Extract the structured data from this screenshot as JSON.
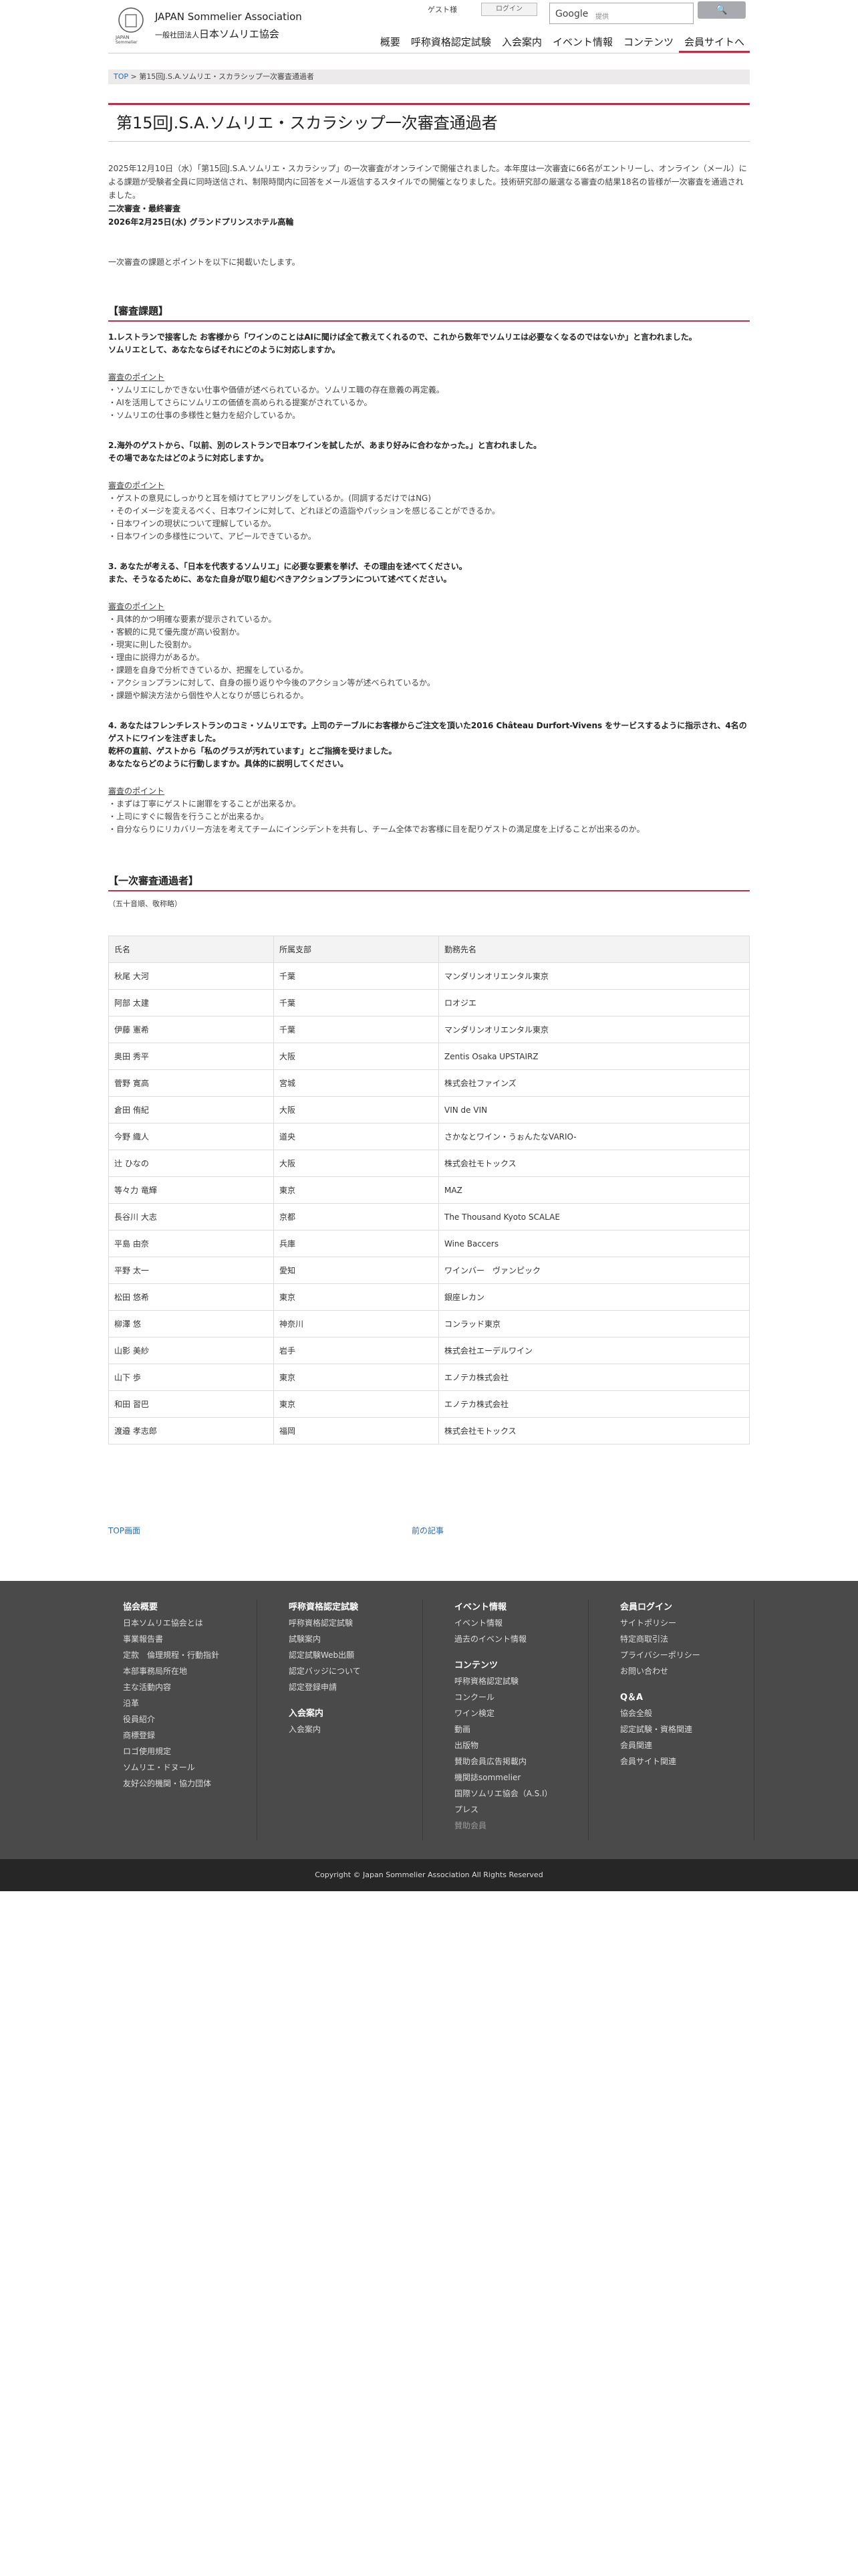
{
  "header": {
    "logo_en": "JAPAN Sommelier Association",
    "logo_jp_small": "一般社団法人",
    "logo_jp": "日本ソムリエ協会",
    "logo_mark_text": "JAPAN Sommelier Association",
    "guest": "ゲスト様",
    "login": "ログイン",
    "search_brand": "Google",
    "search_placeholder": "提供",
    "search_icon": "search-icon",
    "nav": [
      "概要",
      "呼称資格認定試験",
      "入会案内",
      "イベント情報",
      "コンテンツ",
      "会員サイトへ"
    ]
  },
  "breadcrumb": {
    "top": "TOP",
    "sep": " > ",
    "current": "第15回J.S.A.ソムリエ・スカラシップ一次審査通過者"
  },
  "page_title": "第15回J.S.A.ソムリエ・スカラシップ一次審査通過者",
  "intro": {
    "p1": "2025年12月10日（水）「第15回J.S.A.ソムリエ・スカラシップ」の一次審査がオンラインで開催されました。本年度は一次審査に66名がエントリーし、オンライン（メール）による課題が受験者全員に同時送信され、制限時間内に回答をメール返信するスタイルでの開催となりました。技術研究部の厳選なる審査の結果18名の皆様が一次審査を通過されました。",
    "sub_title": "二次審査・最終審査",
    "sub_date": "2026年2月25日(水) グランドプリンスホテル高輪",
    "p2": "一次審査の課題とポイントを以下に掲載いたします。"
  },
  "task_section": {
    "heading": "【審査課題】",
    "questions": [
      {
        "q": [
          "1.レストランで接客した お客様から「ワインのことはAIに聞けば全て教えてくれるので、これから数年でソムリエは必要なくなるのではないか」と言われました。",
          "ソムリエとして、あなたならばそれにどのように対応しますか。"
        ],
        "point_label": "審査のポイント",
        "points": [
          "・ソムリエにしかできない仕事や価値が述べられているか。ソムリエ職の存在意義の再定義。",
          "・AIを活用してさらにソムリエの価値を高められる提案がされているか。",
          "・ソムリエの仕事の多様性と魅力を紹介しているか。"
        ]
      },
      {
        "q": [
          "2.海外のゲストから、「以前、別のレストランで日本ワインを試したが、あまり好みに合わなかった。」と言われました。",
          "その場であなたはどのように対応しますか。"
        ],
        "point_label": "審査のポイント",
        "points": [
          "・ゲストの意見にしっかりと耳を傾けてヒアリングをしているか。(同調するだけではNG)",
          "・そのイメージを変えるべく、日本ワインに対して、どれほどの造詣やパッションを感じることができるか。",
          "・日本ワインの現状について理解しているか。",
          "・日本ワインの多様性について、アピールできているか。"
        ]
      },
      {
        "q": [
          "3. あなたが考える、「日本を代表するソムリエ」に必要な要素を挙げ、その理由を述べてください。",
          "また、そうなるために、あなた自身が取り組むべきアクションプランについて述べてください。"
        ],
        "point_label": "審査のポイント",
        "points": [
          "・具体的かつ明確な要素が提示されているか。",
          "・客観的に見て優先度が高い役割か。",
          "・現実に則した役割か。",
          "・理由に説得力があるか。",
          "・課題を自身で分析できているか、把握をしているか。",
          "・アクションプランに対して、自身の振り返りや今後のアクション等が述べられているか。",
          "・課題や解決方法から個性や人となりが感じられるか。"
        ]
      },
      {
        "q": [
          "4. あなたはフレンチレストランのコミ・ソムリエです。上司のテーブルにお客様からご注文を頂いた2016 Château Durfort-Vivens をサービスするように指示され、4名のゲストにワインを注ぎました。",
          "乾杯の直前、ゲストから「私のグラスが汚れています」とご指摘を受けました。",
          "あなたならどのように行動しますか。具体的に説明してください。"
        ],
        "point_label": "審査のポイント",
        "points": [
          "・まずは丁寧にゲストに謝罪をすることが出来るか。",
          "・上司にすぐに報告を行うことが出来るか。",
          "・自分ならりにリカバリー方法を考えてチームにインシデントを共有し、チーム全体でお客様に目を配りゲストの満足度を上げることが出来るのか。"
        ]
      }
    ]
  },
  "pass_section": {
    "heading": "【一次審査通過者】",
    "note": "（五十音順、敬称略）",
    "columns": [
      "氏名",
      "所属支部",
      "勤務先名"
    ],
    "rows": [
      [
        "秋尾 大河",
        "千葉",
        "マンダリンオリエンタル東京"
      ],
      [
        "阿部 太建",
        "千葉",
        "ロオジエ"
      ],
      [
        "伊藤 憲希",
        "千葉",
        "マンダリンオリエンタル東京"
      ],
      [
        "奥田 秀平",
        "大阪",
        "Zentis Osaka UPSTAIRZ"
      ],
      [
        "菅野 寛高",
        "宮城",
        "株式会社ファインズ"
      ],
      [
        "倉田 侑紀",
        "大阪",
        "VIN de VIN"
      ],
      [
        "今野 織人",
        "道央",
        "さかなとワイン・うぉんたなVARIO-"
      ],
      [
        "辻 ひなの",
        "大阪",
        "株式会社モトックス"
      ],
      [
        "等々力 竜輝",
        "東京",
        "MAZ"
      ],
      [
        "長谷川 大志",
        "京都",
        "The Thousand Kyoto SCALAE"
      ],
      [
        "平島 由奈",
        "兵庫",
        "Wine Baccers"
      ],
      [
        "平野 太一",
        "愛知",
        "ワインバー　ヴァンピック"
      ],
      [
        "松田 悠希",
        "東京",
        "銀座レカン"
      ],
      [
        "柳澤 悠",
        "神奈川",
        "コンラッド東京"
      ],
      [
        "山影 美紗",
        "岩手",
        "株式会社エーデルワイン"
      ],
      [
        "山下 歩",
        "東京",
        "エノテカ株式会社"
      ],
      [
        "和田 習巴",
        "東京",
        "エノテカ株式会社"
      ],
      [
        "渡邉 孝志郎",
        "福岡",
        "株式会社モトックス"
      ]
    ]
  },
  "pager": {
    "top": "TOP画面",
    "prev": "前の記事"
  },
  "footer": {
    "col1": {
      "title": "協会概要",
      "items": [
        "日本ソムリエ協会とは",
        "事業報告書",
        "定款　倫理規程・行動指針",
        "本部事務局所在地",
        "主な活動内容",
        "沿革",
        "役員紹介",
        "商標登録",
        "ロゴ使用規定",
        "ソムリエ・ドヌール",
        "友好公的機関・協力団体"
      ]
    },
    "col2": {
      "title": "呼称資格認定試験",
      "items": [
        "呼称資格認定試験",
        "試験案内",
        "認定試験Web出願",
        "認定バッジについて",
        "認定登録申請"
      ],
      "title2": "入会案内",
      "items2": [
        "入会案内"
      ]
    },
    "col3": {
      "title": "イベント情報",
      "items": [
        "イベント情報",
        "過去のイベント情報"
      ],
      "title2": "コンテンツ",
      "items2": [
        "呼称資格認定試験",
        "コンクール",
        "ワイン検定",
        "動画",
        "出版物",
        "賛助会員広告掲載内",
        "機関誌sommelier",
        "国際ソムリエ協会（A.S.I）",
        "プレス",
        "賛助会員"
      ]
    },
    "col4": {
      "title": "会員ログイン",
      "items": [
        "サイトポリシー",
        "特定商取引法",
        "プライバシーポリシー",
        "お問い合わせ"
      ],
      "title2": "Q＆A",
      "items2": [
        "協会全般",
        "認定試験・資格関連",
        "会員関連",
        "会員サイト関連"
      ]
    },
    "copyright": "Copyright © Japan Sommelier Association All Rights Reserved"
  },
  "colors": {
    "accent": "#b0344c",
    "footer_bg": "#4a4a4a",
    "copyright_bg": "#262626",
    "link": "#2a6db0"
  }
}
